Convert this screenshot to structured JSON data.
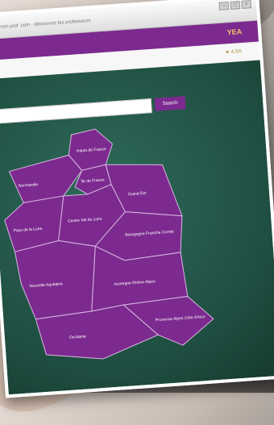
{
  "browser": {
    "address": "mon prof .com - découvrez les professeurs",
    "controls": [
      "–",
      "□",
      "×"
    ]
  },
  "header": {
    "logo": "YEA",
    "star_text": "★ 4,5/5"
  },
  "search": {
    "button_label": "Search"
  },
  "map_regions": [
    {
      "name": "Hauts de France"
    },
    {
      "name": "Normandie"
    },
    {
      "name": "Île de France"
    },
    {
      "name": "Grand Est"
    },
    {
      "name": "Pays de la Loire"
    },
    {
      "name": "Centre Val de Loire"
    },
    {
      "name": "Bourgogne Franche Comté"
    },
    {
      "name": "Nouvelle Aquitaine"
    },
    {
      "name": "Auvergne Rhône Alpes"
    },
    {
      "name": "Occitanie"
    },
    {
      "name": "Provence Alpes Côte d'Azur"
    }
  ],
  "colors": {
    "brand": "#7c2a8f",
    "accent": "#f0c96a",
    "board": "#2f6b5a"
  }
}
